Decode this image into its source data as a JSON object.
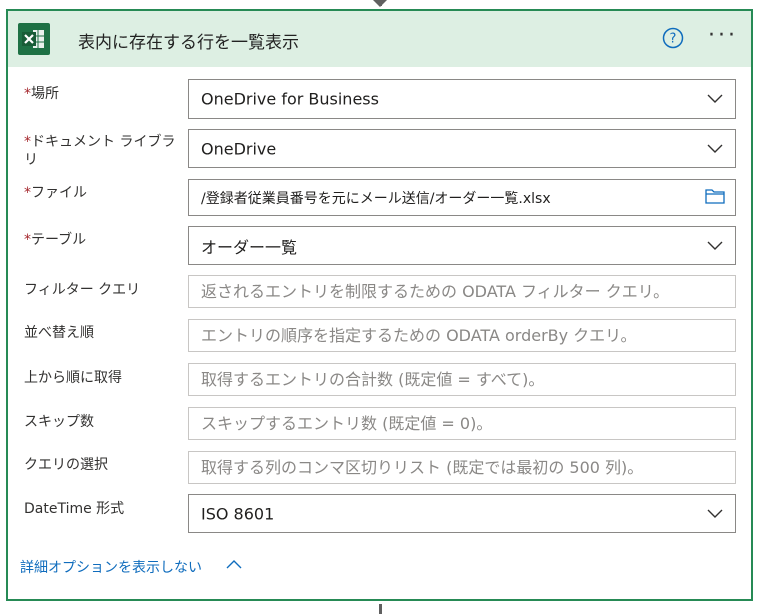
{
  "card": {
    "title": "表内に存在する行を一覧表示",
    "icons": {
      "app": "excel-icon",
      "help": "help-icon",
      "more": "more-icon"
    },
    "more_label": "···"
  },
  "fields": {
    "location": {
      "label": "場所",
      "required": true,
      "value": "OneDrive for Business"
    },
    "document_library": {
      "label": "ドキュメント ライブラリ",
      "required": true,
      "value": "OneDrive"
    },
    "file": {
      "label": "ファイル",
      "required": true,
      "value": "/登録者従業員番号を元にメール送信/オーダー一覧.xlsx"
    },
    "table": {
      "label": "テーブル",
      "required": true,
      "value": "オーダー一覧"
    },
    "filter_query": {
      "label": "フィルター クエリ",
      "value": "",
      "placeholder": "返されるエントリを制限するための ODATA フィルター クエリ。"
    },
    "order_by": {
      "label": "並べ替え順",
      "value": "",
      "placeholder": "エントリの順序を指定するための ODATA orderBy クエリ。"
    },
    "top_count": {
      "label": "上から順に取得",
      "value": "",
      "placeholder": "取得するエントリの合計数 (既定値 = すべて)。"
    },
    "skip_count": {
      "label": "スキップ数",
      "value": "",
      "placeholder": "スキップするエントリ数 (既定値 = 0)。"
    },
    "select_query": {
      "label": "クエリの選択",
      "value": "",
      "placeholder": "取得する列のコンマ区切りリスト (既定では最初の 500 列)。"
    },
    "datetime_format": {
      "label": "DateTime 形式",
      "value": "ISO 8601"
    }
  },
  "required_marker": "*",
  "advanced_toggle": "詳細オプションを表示しない",
  "colors": {
    "header_bg": "#ddefe3",
    "border": "#268a55",
    "excel_green": "#1e7145",
    "link": "#0f6cbd",
    "required": "#a4262c"
  }
}
